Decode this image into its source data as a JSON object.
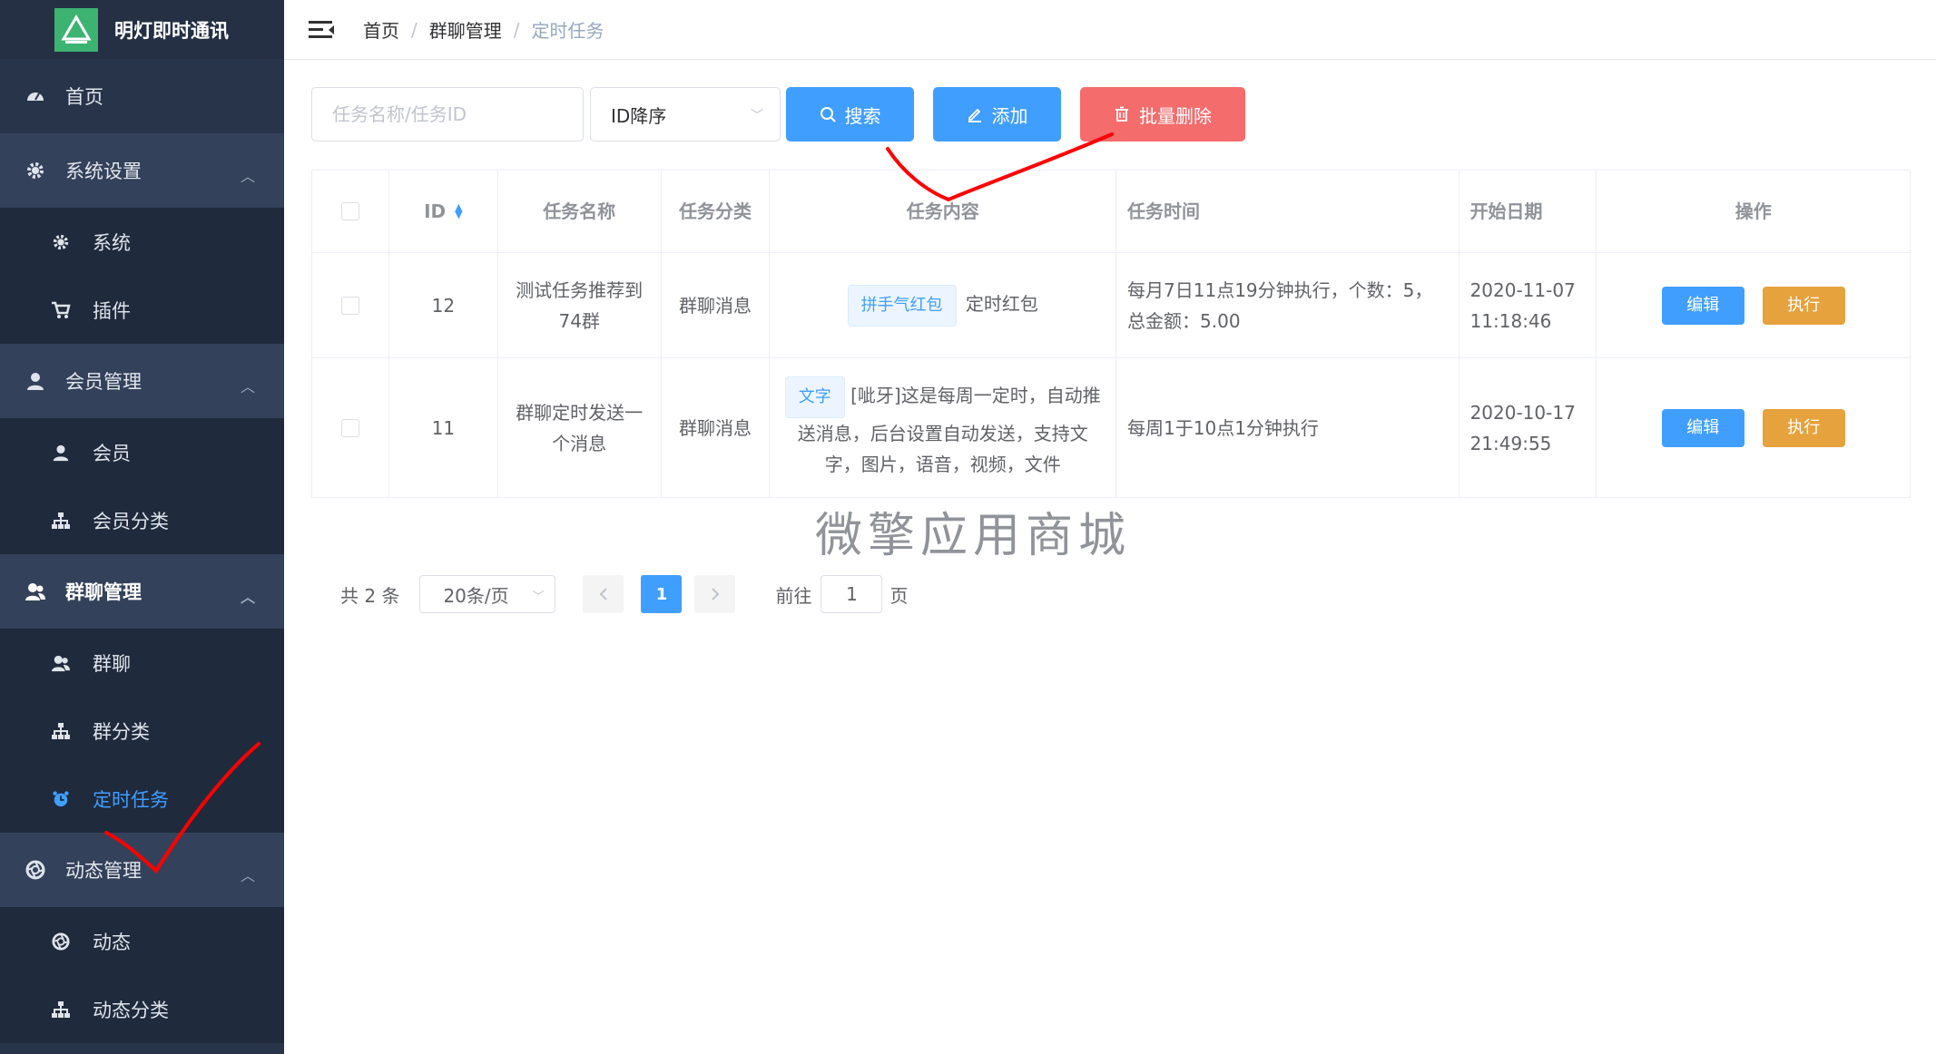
{
  "app": {
    "title": "明灯即时通讯",
    "logo_caption": "明灯即时通讯"
  },
  "sidebar": {
    "home": {
      "label": "首页",
      "icon": "dashboard-icon"
    },
    "groups": [
      {
        "label": "系统设置",
        "icon": "gear-icon",
        "items": [
          {
            "label": "系统",
            "icon": "gear-icon"
          },
          {
            "label": "插件",
            "icon": "cart-icon"
          }
        ]
      },
      {
        "label": "会员管理",
        "icon": "user-icon",
        "items": [
          {
            "label": "会员",
            "icon": "user-icon"
          },
          {
            "label": "会员分类",
            "icon": "sitemap-icon"
          }
        ]
      },
      {
        "label": "群聊管理",
        "icon": "users-icon",
        "items": [
          {
            "label": "群聊",
            "icon": "users-icon"
          },
          {
            "label": "群分类",
            "icon": "sitemap-icon"
          },
          {
            "label": "定时任务",
            "icon": "alarm-clock-icon",
            "active": true
          }
        ]
      },
      {
        "label": "动态管理",
        "icon": "aperture-icon",
        "items": [
          {
            "label": "动态",
            "icon": "aperture-icon"
          },
          {
            "label": "动态分类",
            "icon": "sitemap-icon"
          }
        ]
      }
    ]
  },
  "breadcrumb": [
    "首页",
    "群聊管理",
    "定时任务"
  ],
  "toolbar": {
    "search_placeholder": "任务名称/任务ID",
    "sort_value": "ID降序",
    "search_label": "搜索",
    "add_label": "添加",
    "batch_delete_label": "批量删除"
  },
  "table": {
    "columns": [
      "",
      "ID",
      "任务名称",
      "任务分类",
      "任务内容",
      "任务时间",
      "开始日期",
      "操作"
    ],
    "rows": [
      {
        "id": "12",
        "name": "测试任务推荐到74群",
        "category": "群聊消息",
        "content_tag": "拼手气红包",
        "content_text": "定时红包",
        "time": "每月7日11点19分钟执行，个数：5，总金额：5.00",
        "start_date": "2020-11-07",
        "start_time": "11:18:46",
        "edit_label": "编辑",
        "run_label": "执行"
      },
      {
        "id": "11",
        "name": "群聊定时发送一个消息",
        "category": "群聊消息",
        "content_tag": "文字",
        "content_text": "[呲牙]这是每周一定时，自动推送消息，后台设置自动发送，支持文字，图片，语音，视频，文件",
        "time": "每周1于10点1分钟执行",
        "start_date": "2020-10-17",
        "start_time": "21:49:55",
        "edit_label": "编辑",
        "run_label": "执行"
      }
    ]
  },
  "watermark": "微擎应用商城",
  "pagination": {
    "total_text": "共 2 条",
    "page_size": "20条/页",
    "current_page": "1",
    "goto_label": "前往",
    "goto_value": "1",
    "page_word": "页"
  },
  "colors": {
    "sidebar": "#28344a",
    "primary": "#409eff",
    "danger": "#f56c6c",
    "warning": "#e6a23c",
    "annotation": "#ff0000"
  }
}
